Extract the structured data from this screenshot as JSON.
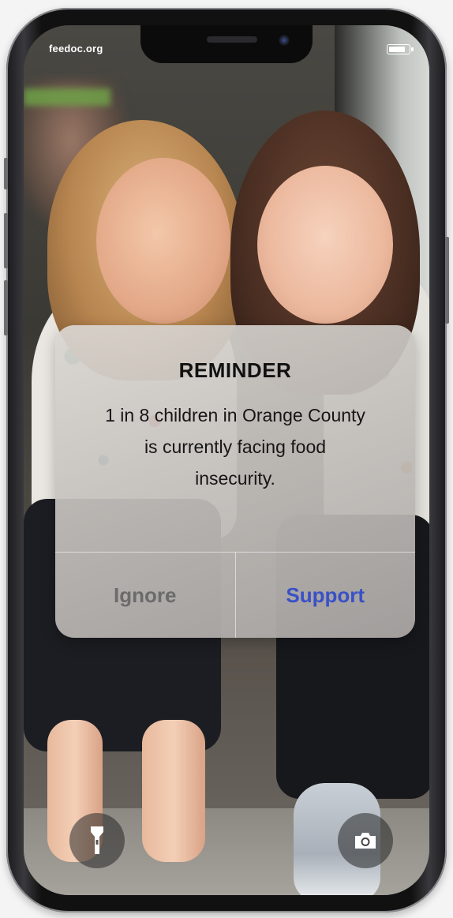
{
  "status_bar": {
    "url": "feedoc.org",
    "battery_level": 0.85
  },
  "alert": {
    "title": "REMINDER",
    "message": "1 in 8 children in Orange County is currently facing food insecurity.",
    "ignore_label": "Ignore",
    "support_label": "Support"
  },
  "lock_screen": {
    "left_icon": "flashlight-icon",
    "right_icon": "camera-icon"
  },
  "colors": {
    "support_blue": "#3950c7",
    "ignore_gray": "#6b6b6b",
    "phone_frame": "#111111"
  }
}
